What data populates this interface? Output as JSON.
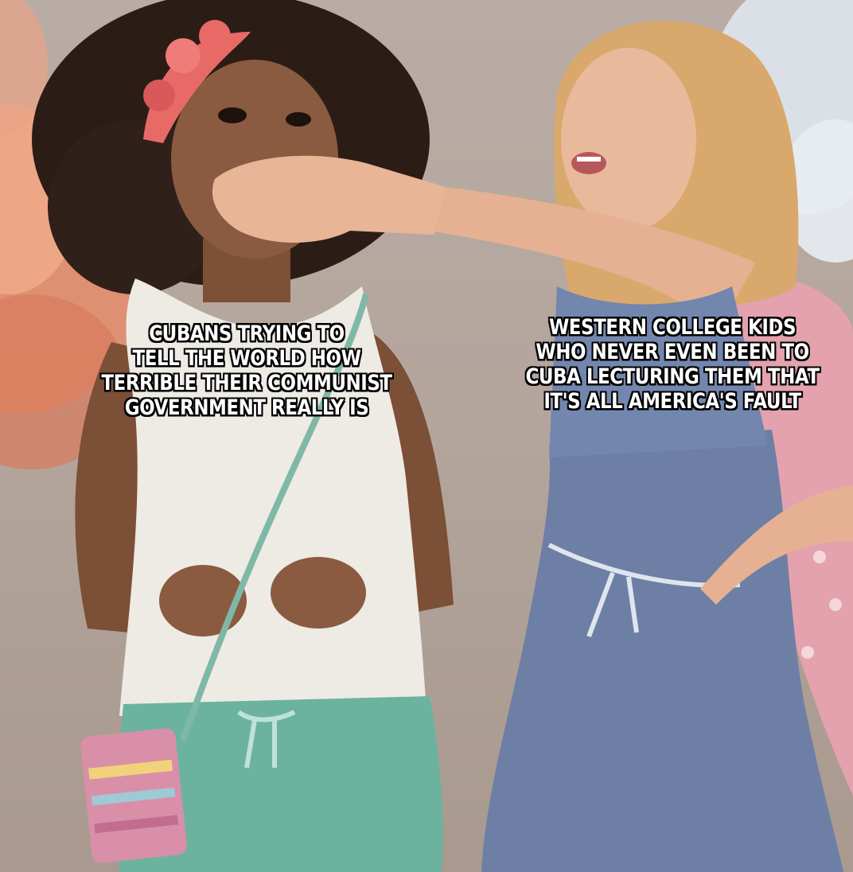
{
  "meme": {
    "left_caption": "CUBANS TRYING TO\nTELL THE WORLD HOW\nTERRIBLE THEIR COMMUNIST\nGOVERNMENT REALLY IS",
    "right_caption": "WESTERN COLLEGE KIDS\nWHO NEVER EVEN BEEN TO\nCUBA LECTURING THEM THAT\nIT'S ALL AMERICA'S FAULT"
  },
  "colors": {
    "background_wall": "#b6a89f",
    "flower_left": "#e58c6a",
    "flower_right": "#dfe6ee",
    "left_hair": "#2b1d16",
    "left_skin": "#8a5b40",
    "left_top": "#eeeae4",
    "left_shorts": "#6bb39e",
    "right_hair": "#d9a86c",
    "right_skin": "#e9b99c",
    "right_dress": "#6d7fa5",
    "right_bag": "#e3a2ad",
    "headband": "#e86a67",
    "caption_text": "#ffffff",
    "caption_outline": "#000000"
  }
}
